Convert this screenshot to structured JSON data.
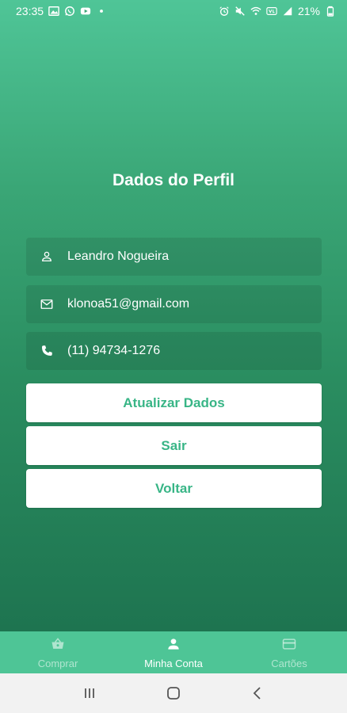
{
  "status_bar": {
    "time": "23:35",
    "battery": "21%",
    "left_icons": [
      "image-icon",
      "whatsapp-icon",
      "youtube-icon",
      "dot-icon"
    ],
    "right_icons": [
      "alarm-icon",
      "mute-icon",
      "wifi-icon",
      "volte-icon",
      "signal-icon",
      "battery-icon"
    ]
  },
  "profile": {
    "title": "Dados do Perfil",
    "name": "Leandro Nogueira",
    "email": "klonoa51@gmail.com",
    "phone": "(11) 94734-1276"
  },
  "buttons": {
    "update": "Atualizar Dados",
    "logout": "Sair",
    "back": "Voltar"
  },
  "bottom_nav": {
    "items": [
      {
        "label": "Comprar",
        "icon": "basket-icon",
        "active": false
      },
      {
        "label": "Minha Conta",
        "icon": "person-icon",
        "active": true
      },
      {
        "label": "Cartões",
        "icon": "card-icon",
        "active": false
      }
    ]
  },
  "colors": {
    "accent": "#38b586",
    "nav_background": "#4ec596",
    "gradient_top": "#4fc597",
    "gradient_bottom": "#1e7450"
  }
}
